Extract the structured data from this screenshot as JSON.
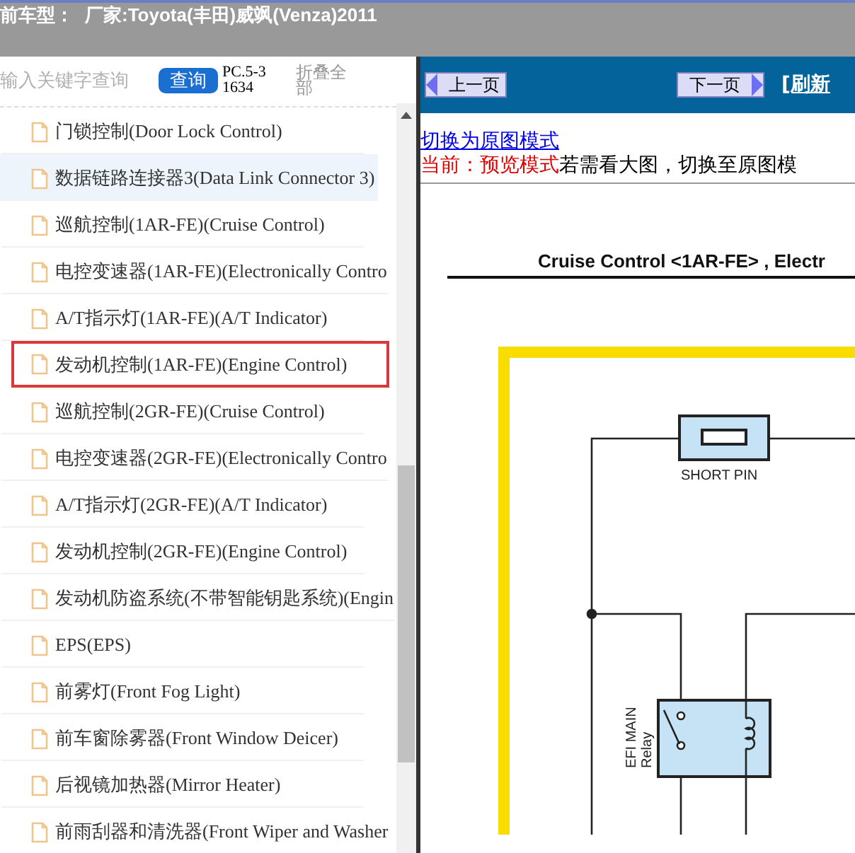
{
  "header": {
    "label": "前车型：",
    "value": "厂家:Toyota(丰田)威飒(Venza)2011"
  },
  "search": {
    "placeholder": "输入关键字查询",
    "button": "查询",
    "code": "PC.5-31634",
    "collapse": "折叠全部"
  },
  "tree": {
    "items": [
      {
        "label": "门锁控制(Door Lock Control)",
        "selected": false,
        "highlighted": false
      },
      {
        "label": "数据链路连接器3(Data Link Connector 3)",
        "selected": true,
        "highlighted": false
      },
      {
        "label": "巡航控制(1AR-FE)(Cruise Control)",
        "selected": false,
        "highlighted": false
      },
      {
        "label": "电控变速器(1AR-FE)(Electronically Contro",
        "selected": false,
        "highlighted": false
      },
      {
        "label": "A/T指示灯(1AR-FE)(A/T Indicator)",
        "selected": false,
        "highlighted": false
      },
      {
        "label": "发动机控制(1AR-FE)(Engine Control)",
        "selected": false,
        "highlighted": true
      },
      {
        "label": "巡航控制(2GR-FE)(Cruise Control)",
        "selected": false,
        "highlighted": false
      },
      {
        "label": "电控变速器(2GR-FE)(Electronically Contro",
        "selected": false,
        "highlighted": false
      },
      {
        "label": "A/T指示灯(2GR-FE)(A/T Indicator)",
        "selected": false,
        "highlighted": false
      },
      {
        "label": "发动机控制(2GR-FE)(Engine Control)",
        "selected": false,
        "highlighted": false
      },
      {
        "label": "发动机防盗系统(不带智能钥匙系统)(Engin",
        "selected": false,
        "highlighted": false
      },
      {
        "label": "EPS(EPS)",
        "selected": false,
        "highlighted": false
      },
      {
        "label": "前雾灯(Front Fog Light)",
        "selected": false,
        "highlighted": false
      },
      {
        "label": "前车窗除雾器(Front Window Deicer)",
        "selected": false,
        "highlighted": false
      },
      {
        "label": "后视镜加热器(Mirror Heater)",
        "selected": false,
        "highlighted": false
      },
      {
        "label": "前雨刮器和清洗器(Front Wiper and Washer",
        "selected": false,
        "highlighted": false
      }
    ]
  },
  "nav": {
    "prev": "上一页",
    "next": "下一页",
    "refresh": "[刷新"
  },
  "content": {
    "mode_link": "切换为原图模式",
    "mode_label": "当前：预览模式",
    "mode_hint": "若需看大图，切换至原图模",
    "diagram": {
      "title": "Cruise Control <1AR-FE> , Electr",
      "fuse_label": "SHORT PIN",
      "relay_name": "EFI MAIN",
      "relay_type": "Relay"
    }
  }
}
